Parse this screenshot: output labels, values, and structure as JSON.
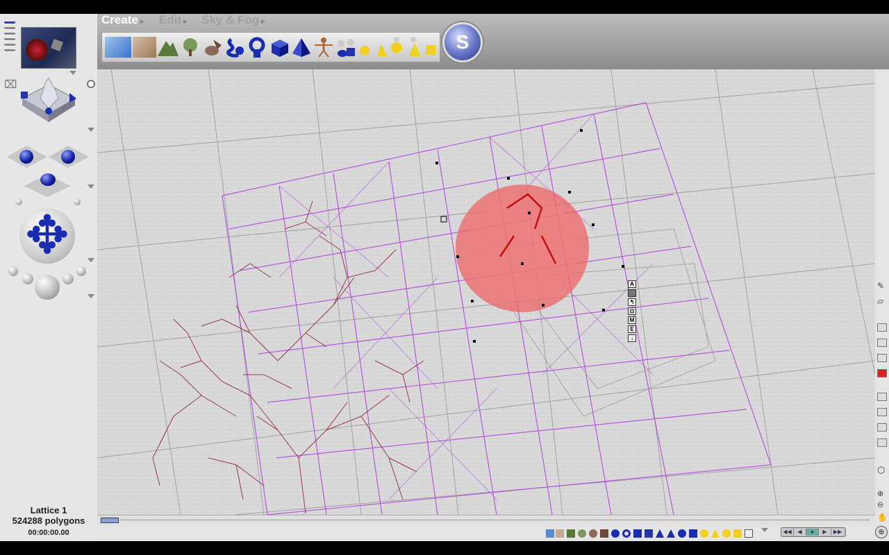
{
  "menu": {
    "create": "Create",
    "edit": "Edit",
    "sky_fog": "Sky & Fog"
  },
  "status": {
    "object_name": "Lattice 1",
    "polygon_count": "524288 polygons",
    "time": "00:00:00.00"
  },
  "side_tools": [
    "A",
    "",
    "",
    "",
    "M",
    "E",
    ""
  ],
  "colors": {
    "lattice": "#b040e0",
    "object_red": "#e03535",
    "tree_branches": "#8a2035",
    "ui_blue": "#1a2cb0"
  },
  "icons": {
    "create_palette": [
      "water-plane-icon",
      "rock-plane-icon",
      "terrain-icon",
      "plant-icon",
      "rock-icon",
      "metablob-icon",
      "spiral-icon",
      "sphere-icon",
      "torus-icon",
      "cylinder-icon",
      "cube-icon",
      "pyramid-icon",
      "cone-icon",
      "figure-icon",
      "disc-icon",
      "light-icons"
    ],
    "poser_button": "poser-logo-icon"
  }
}
